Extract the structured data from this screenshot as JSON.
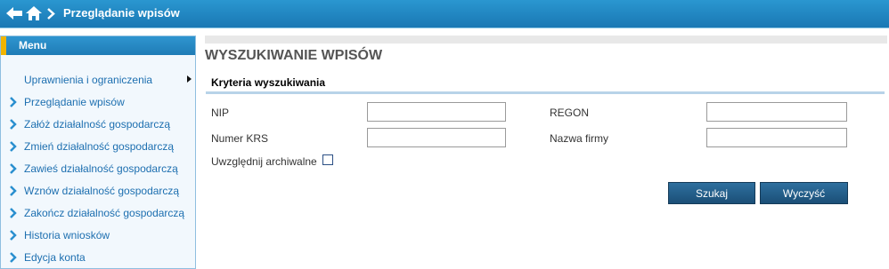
{
  "header": {
    "title": "Przeglądanie wpisów",
    "back_icon": "back-arrow-icon",
    "home_icon": "home-icon",
    "separator_icon": "chevron-right-icon"
  },
  "menu": {
    "title": "Menu",
    "items": [
      {
        "label": "Uprawnienia i ograniczenia",
        "icon": "triangle-right-icon"
      },
      {
        "label": "Przeglądanie wpisów",
        "icon": "chevron-right-icon"
      },
      {
        "label": "Załóż działalność gospodarczą",
        "icon": "chevron-right-icon"
      },
      {
        "label": "Zmień działalność gospodarczą",
        "icon": "chevron-right-icon"
      },
      {
        "label": "Zawieś działalność gospodarczą",
        "icon": "chevron-right-icon"
      },
      {
        "label": "Wznów działalność gospodarczą",
        "icon": "chevron-right-icon"
      },
      {
        "label": "Zakończ działalność gospodarczą",
        "icon": "chevron-right-icon"
      },
      {
        "label": "Historia wniosków",
        "icon": "chevron-right-icon"
      },
      {
        "label": "Edycja konta",
        "icon": "chevron-right-icon"
      }
    ]
  },
  "main": {
    "title": "WYSZUKIWANIE WPISÓW",
    "section_title": "Kryteria wyszukiwania",
    "fields": {
      "nip": {
        "label": "NIP",
        "value": ""
      },
      "regon": {
        "label": "REGON",
        "value": ""
      },
      "krs": {
        "label": "Numer KRS",
        "value": ""
      },
      "firma": {
        "label": "Nazwa firmy",
        "value": ""
      }
    },
    "archive_label": "Uwzględnij archiwalne",
    "archive_checked": false,
    "search_button": "Szukaj",
    "clear_button": "Wyczyść"
  },
  "colors": {
    "header_bg": "#1a78b4",
    "menu_accent": "#f0b400",
    "link": "#1d6fb0",
    "button_bg": "#1b4f77"
  }
}
